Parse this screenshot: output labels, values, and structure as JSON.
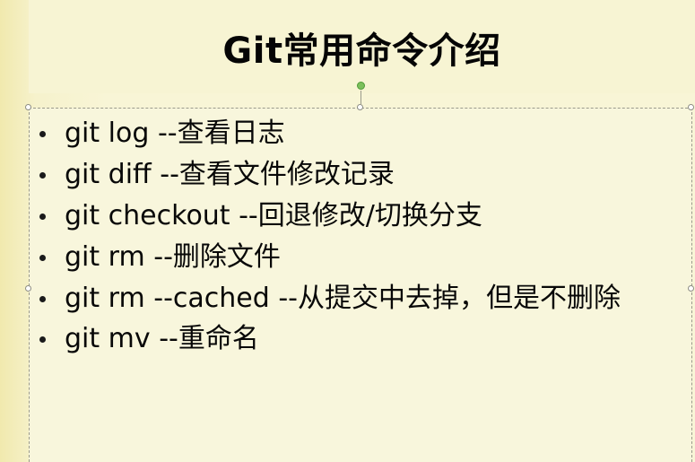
{
  "slide": {
    "title": "Git常用命令介绍",
    "items": [
      {
        "text": "git log  --查看日志"
      },
      {
        "text": "git diff  --查看文件修改记录"
      },
      {
        "text": "git checkout  --回退修改/切换分支"
      },
      {
        "text": "git rm  --删除文件"
      },
      {
        "text": "git rm --cached  --从提交中去掉，但是不删除"
      },
      {
        "text": "git mv  --重命名"
      }
    ]
  }
}
